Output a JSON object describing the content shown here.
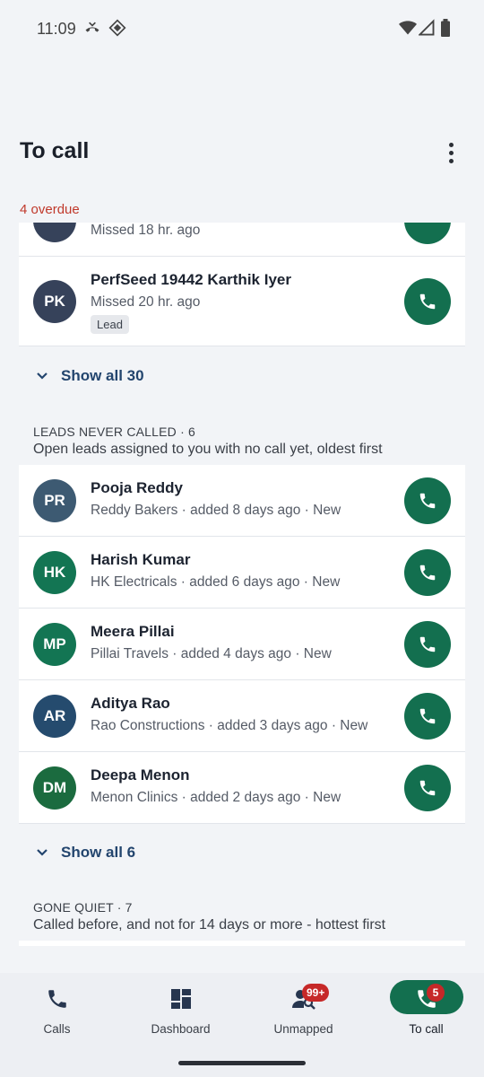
{
  "status": {
    "time": "11:09"
  },
  "header": {
    "title": "To call"
  },
  "overdue": {
    "label": "4 overdue",
    "partial_row": {
      "subtitle": "Missed 18 hr. ago"
    },
    "rows": [
      {
        "initials": "PK",
        "name": "PerfSeed 19442 Karthik Iyer",
        "subtitle": "Missed 20 hr. ago",
        "tag": "Lead",
        "avatar_color": "#36425a"
      }
    ],
    "show_all": "Show all 30"
  },
  "leads_never_called": {
    "heading": "LEADS NEVER CALLED · 6",
    "description": "Open leads assigned to you with no call yet, oldest first",
    "rows": [
      {
        "initials": "PR",
        "name": "Pooja Reddy",
        "subtitle": "Reddy Bakers · added 8 days ago · New",
        "avatar_color": "#3d5a72"
      },
      {
        "initials": "HK",
        "name": "Harish Kumar",
        "subtitle": "HK Electricals · added 6 days ago · New",
        "avatar_color": "#137553"
      },
      {
        "initials": "MP",
        "name": "Meera Pillai",
        "subtitle": "Pillai Travels · added 4 days ago · New",
        "avatar_color": "#137553"
      },
      {
        "initials": "AR",
        "name": "Aditya Rao",
        "subtitle": "Rao Constructions · added 3 days ago · New",
        "avatar_color": "#254b6e"
      },
      {
        "initials": "DM",
        "name": "Deepa Menon",
        "subtitle": "Menon Clinics · added 2 days ago · New",
        "avatar_color": "#1b6b3f"
      }
    ],
    "show_all": "Show all 6"
  },
  "gone_quiet": {
    "heading": "GONE QUIET · 7",
    "description": "Called before, and not for 14 days or more - hottest first"
  },
  "bottom_nav": {
    "items": [
      {
        "label": "Calls",
        "icon": "phone-icon"
      },
      {
        "label": "Dashboard",
        "icon": "dashboard-icon"
      },
      {
        "label": "Unmapped",
        "icon": "person-search-icon",
        "badge": "99+"
      },
      {
        "label": "To call",
        "icon": "phone-icon",
        "badge": "5",
        "active": true
      }
    ]
  },
  "colors": {
    "accent": "#136f4f",
    "overdue": "#c0392b",
    "link": "#23456e",
    "badge": "#c62828"
  }
}
